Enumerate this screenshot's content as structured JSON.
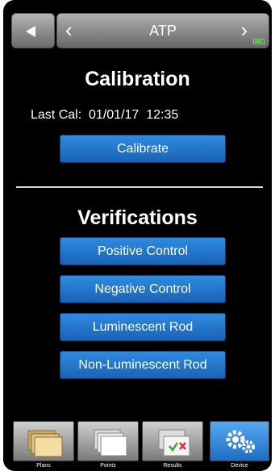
{
  "header": {
    "title": "ATP",
    "back_icon": "back-triangle-icon",
    "prev_icon": "chevron-left-icon",
    "next_icon": "chevron-right-icon",
    "battery_icon": "battery-icon"
  },
  "calibration": {
    "heading": "Calibration",
    "last_cal": "Last Cal:  01/01/17  12:35",
    "calibrate_label": "Calibrate"
  },
  "verifications": {
    "heading": "Verifications",
    "buttons": [
      "Positive Control",
      "Negative Control",
      "Luminescent Rod",
      "Non-Luminescent Rod"
    ]
  },
  "tabs": [
    {
      "label": "Plans",
      "icon": "folders-icon"
    },
    {
      "label": "Points",
      "icon": "pages-icon"
    },
    {
      "label": "Results",
      "icon": "check-cross-icon"
    },
    {
      "label": "Device",
      "icon": "gears-icon"
    }
  ],
  "colors": {
    "button_blue": "#1f6fc8",
    "active_tab": "#2f86d8",
    "background": "#000000"
  }
}
